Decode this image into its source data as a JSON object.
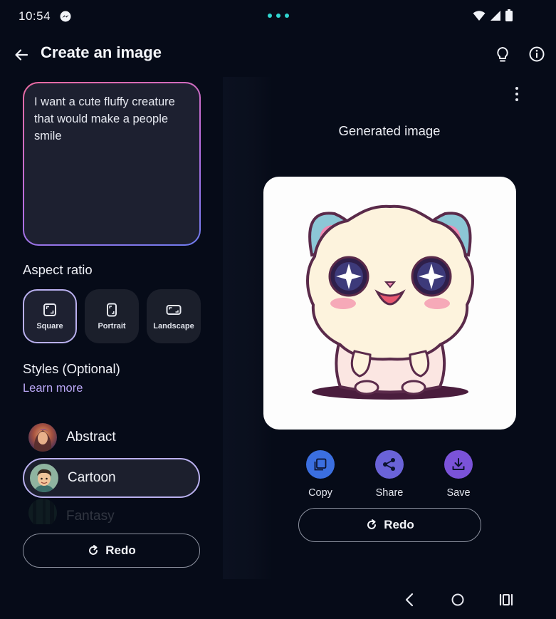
{
  "status": {
    "time": "10:54"
  },
  "header": {
    "title": "Create an image"
  },
  "prompt": {
    "text": "I want a cute fluffy creature that would make a people smile"
  },
  "aspect": {
    "label": "Aspect ratio",
    "options": [
      {
        "label": "Square",
        "icon": "square-ratio-icon",
        "selected": true
      },
      {
        "label": "Portrait",
        "icon": "portrait-ratio-icon",
        "selected": false
      },
      {
        "label": "Landscape",
        "icon": "landscape-ratio-icon",
        "selected": false
      }
    ]
  },
  "styles": {
    "label": "Styles (Optional)",
    "learn_more": "Learn more",
    "items": [
      {
        "label": "Abstract",
        "selected": false
      },
      {
        "label": "Cartoon",
        "selected": true
      },
      {
        "label": "Fantasy",
        "selected": false
      }
    ]
  },
  "left_redo": "Redo",
  "result": {
    "title": "Generated image",
    "actions": [
      {
        "label": "Copy",
        "icon": "copy-icon",
        "color": "#3b6fe0"
      },
      {
        "label": "Share",
        "icon": "share-icon",
        "color": "#6a63d8"
      },
      {
        "label": "Save",
        "icon": "download-icon",
        "color": "#7b53d9"
      }
    ],
    "redo": "Redo"
  },
  "colors": {
    "accent": "#b9a7f5",
    "background": "#060b18"
  }
}
